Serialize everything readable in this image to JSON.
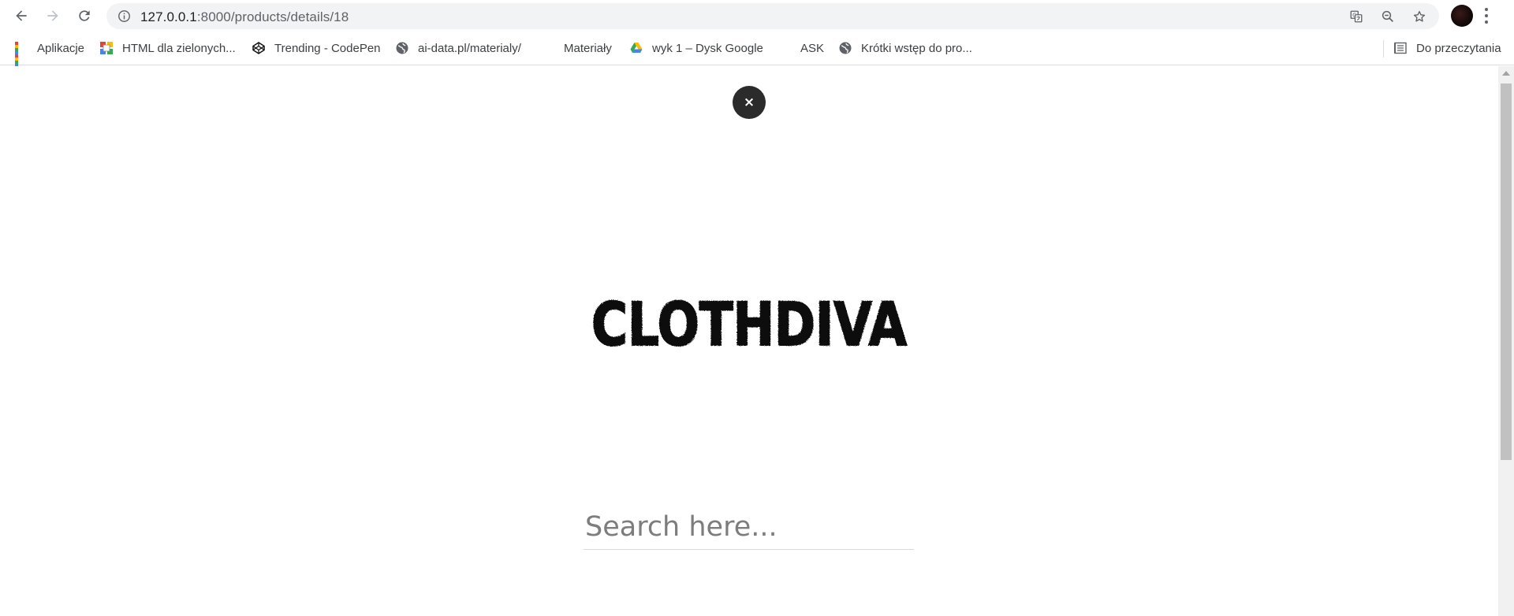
{
  "browser": {
    "url_host": "127.0.0.1",
    "url_rest": ":8000/products/details/18",
    "bookmarks": [
      {
        "label": "Aplikacje",
        "icon": "apps-grid-icon"
      },
      {
        "label": "HTML dla zielonych...",
        "icon": "site-favicon-icon"
      },
      {
        "label": "Trending - CodePen",
        "icon": "codepen-icon"
      },
      {
        "label": "ai-data.pl/materialy/",
        "icon": "globe-icon"
      },
      {
        "label": "Materiały",
        "icon": "blank-page-icon"
      },
      {
        "label": "wyk 1 – Dysk Google",
        "icon": "google-drive-icon"
      },
      {
        "label": "ASK",
        "icon": "blank-page-icon"
      },
      {
        "label": "Krótki wstęp do pro...",
        "icon": "globe-icon"
      }
    ],
    "reading_list": {
      "label": "Do przeczytania",
      "icon": "reading-list-icon"
    }
  },
  "page": {
    "close_label": "×",
    "logo_text": "CLOTHDIVA",
    "search": {
      "placeholder": "Search here...",
      "value": ""
    }
  },
  "colors": {
    "close_bg": "#2b2b2b",
    "logo": "#111111",
    "omnibox_bg": "#f1f3f4"
  }
}
